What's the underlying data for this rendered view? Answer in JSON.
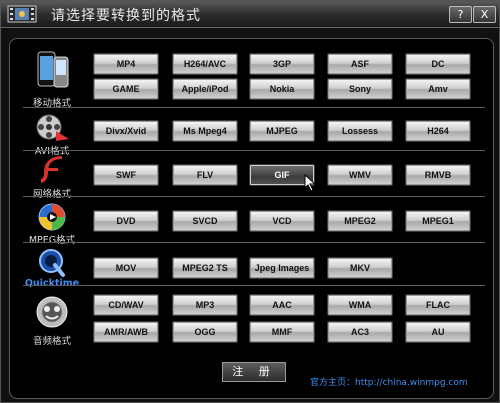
{
  "window": {
    "title": "请选择要转换到的格式",
    "help_label": "?",
    "close_label": "X"
  },
  "categories": [
    {
      "label": "移动格式",
      "icon": "mobile-phone-icon",
      "formats": [
        "MP4",
        "H264/AVC",
        "3GP",
        "ASF",
        "DC",
        "GAME",
        "Apple/iPod",
        "Nokia",
        "Sony",
        "Amv"
      ]
    },
    {
      "label": "AVI格式",
      "icon": "film-reel-icon",
      "formats": [
        "Divx/Xvid",
        "Ms Mpeg4",
        "MJPEG",
        "Lossess",
        "H264"
      ]
    },
    {
      "label": "网络格式",
      "icon": "flash-icon",
      "formats": [
        "SWF",
        "FLV",
        "GIF",
        "WMV",
        "RMVB"
      ]
    },
    {
      "label": "MPEG格式",
      "icon": "mpeg-disc-icon",
      "formats": [
        "DVD",
        "SVCD",
        "VCD",
        "MPEG2",
        "MPEG1"
      ]
    },
    {
      "label": "Quicktime",
      "icon": "quicktime-icon",
      "formats": [
        "MOV",
        "MPEG2 TS",
        "Jpeg Images",
        "MKV"
      ]
    },
    {
      "label": "音频格式",
      "icon": "audio-speaker-icon",
      "formats": [
        "CD/WAV",
        "MP3",
        "AAC",
        "WMA",
        "FLAC",
        "AMR/AWB",
        "OGG",
        "MMF",
        "AC3",
        "AU"
      ]
    }
  ],
  "selected_format": "GIF",
  "footer": {
    "register_label": "注 册",
    "homepage_text": "官方主页：http://china.winmpg.com"
  }
}
